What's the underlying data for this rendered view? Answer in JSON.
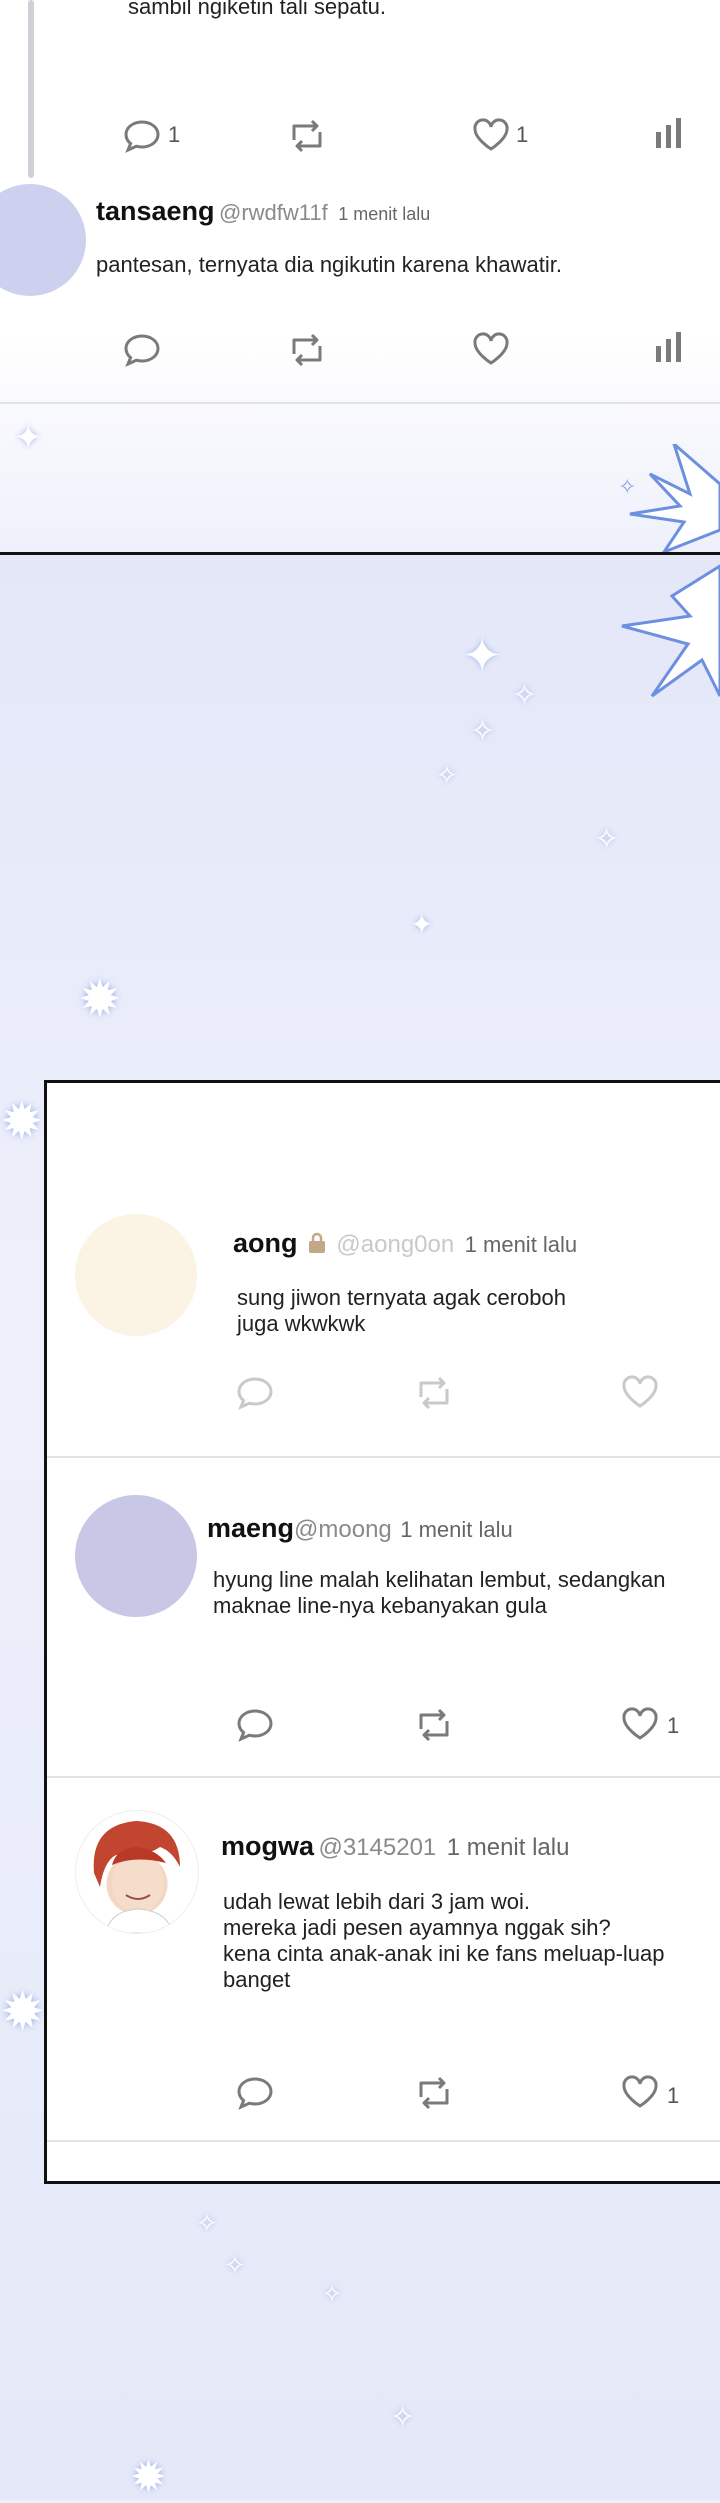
{
  "top_panel": {
    "post1": {
      "text_tail": "sambil ngiketin tali sepatu.",
      "reply_count": "1",
      "like_count": "1"
    },
    "post2": {
      "name": "tansaeng",
      "handle": "@rwdfw11f",
      "time": "1 menit lalu",
      "text": "pantesan, ternyata dia ngikutin karena khawatir."
    }
  },
  "card": {
    "posts": [
      {
        "name": "aong",
        "handle": "@aong0on",
        "time": "1 menit lalu",
        "text_lines": [
          "sung jiwon ternyata agak ceroboh",
          "juga wkwkwk"
        ],
        "like_count": ""
      },
      {
        "name": "maeng",
        "handle": "@moong",
        "time": "1 menit lalu",
        "text_lines": [
          "hyung line malah kelihatan lembut, sedangkan",
          "maknae line-nya kebanyakan gula"
        ],
        "like_count": "1"
      },
      {
        "name": "mogwa",
        "handle": "@3145201",
        "time": "1 menit lalu",
        "text_lines": [
          "udah lewat lebih dari 3 jam woi.",
          "mereka jadi pesen ayamnya nggak sih?",
          "kena cinta anak-anak ini ke fans meluap-luap",
          "banget"
        ],
        "like_count": "1"
      }
    ]
  },
  "colors": {
    "icon_gray": "#7a7a7a",
    "icon_light": "#c9c9c9",
    "avatar_lavender": "#cdd1ef",
    "avatar_lilac": "#c9c7e6",
    "avatar_faded": "#fbf3e4",
    "spark_blue": "#6d8fe0"
  },
  "icons": [
    "reply-icon",
    "retweet-icon",
    "like-icon",
    "stats-icon",
    "lock-icon"
  ]
}
